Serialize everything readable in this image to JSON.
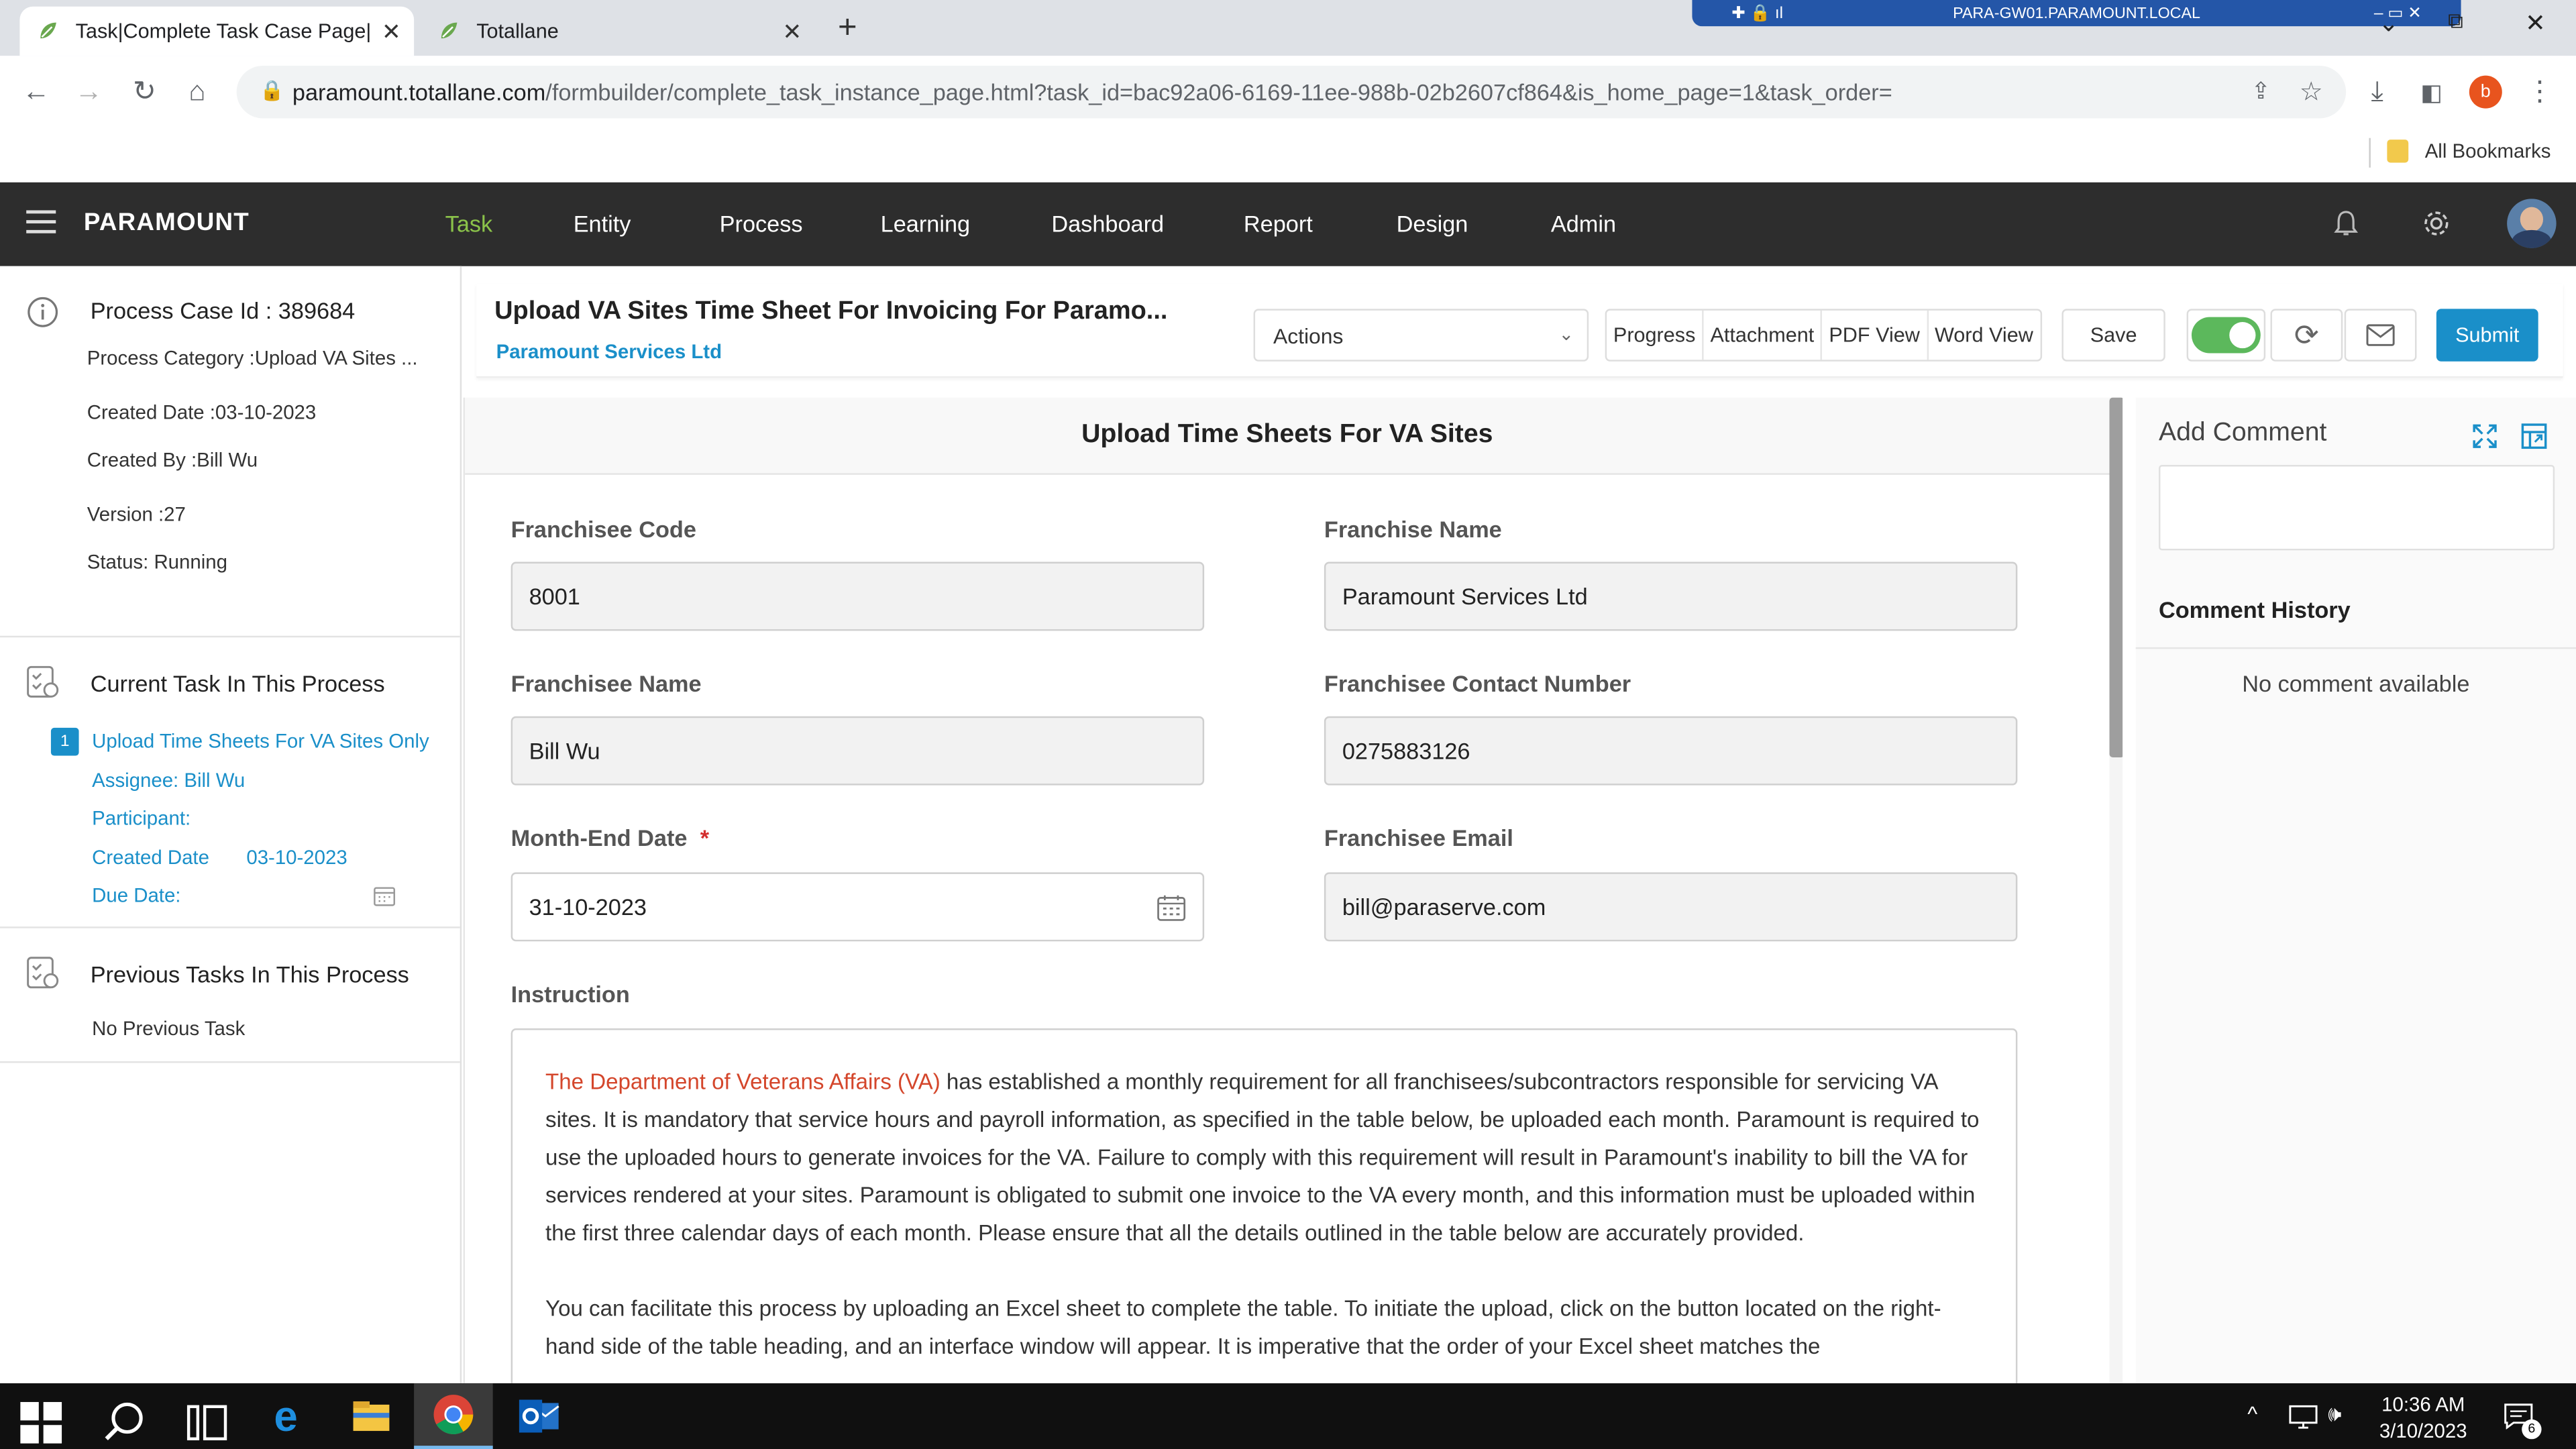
{
  "browser": {
    "tabs": [
      {
        "title": "Task|Complete Task Case Page|To"
      },
      {
        "title": "Totallane"
      }
    ],
    "new_tab": "+",
    "rdp_host": "PARA-GW01.PARAMOUNT.LOCAL",
    "url_host": "paramount.totallane.com",
    "url_path": "/formbuilder/complete_task_instance_page.html?task_id=bac92a06-6169-11ee-988b-02b2607cf864&is_home_page=1&task_order=",
    "profile_initial": "b",
    "bookmarks_label": "All Bookmarks"
  },
  "app": {
    "brand": "PARAMOUNT",
    "nav": [
      "Task",
      "Entity",
      "Process",
      "Learning",
      "Dashboard",
      "Report",
      "Design",
      "Admin"
    ],
    "active_nav": "Task"
  },
  "case": {
    "id_line": "Process Case Id : 389684",
    "category": "Process Category :Upload VA Sites ...",
    "created_date": "Created Date :03-10-2023",
    "created_by": "Created By :Bill Wu",
    "version": "Version :27",
    "status": "Status: Running"
  },
  "current_task": {
    "heading": "Current Task In This Process",
    "number": "1",
    "name": "Upload Time Sheets For VA Sites Only",
    "assignee": "Assignee: Bill Wu",
    "participant": "Participant:",
    "created_label": "Created Date",
    "created_value": "03-10-2023",
    "due_label": "Due Date:"
  },
  "previous_tasks": {
    "heading": "Previous Tasks In This Process",
    "empty": "No Previous Task"
  },
  "task_header": {
    "title": "Upload VA Sites Time Sheet For Invoicing For Paramo...",
    "company": "Paramount Services Ltd",
    "actions_placeholder": "Actions",
    "buttons": [
      "Progress",
      "Attachment",
      "PDF View",
      "Word View"
    ],
    "save": "Save",
    "submit": "Submit",
    "toggle_on": true
  },
  "form": {
    "title": "Upload Time Sheets For VA Sites",
    "fields": {
      "franchisee_code": {
        "label": "Franchisee Code",
        "value": "8001"
      },
      "franchise_name": {
        "label": "Franchise Name",
        "value": "Paramount Services Ltd"
      },
      "franchisee_name": {
        "label": "Franchisee Name",
        "value": "Bill Wu"
      },
      "franchisee_contact": {
        "label": "Franchisee Contact Number",
        "value": "0275883126"
      },
      "month_end_date": {
        "label": "Month-End Date",
        "required_mark": "*",
        "value": "31-10-2023"
      },
      "franchisee_email": {
        "label": "Franchisee Email",
        "value": "bill@paraserve.com"
      }
    },
    "instruction_label": "Instruction",
    "instruction": {
      "highlight": "The Department of Veterans Affairs (VA)",
      "para1_rest": " has established a monthly requirement for all franchisees/subcontractors responsible for servicing VA sites. It is mandatory that service hours and payroll information, as specified in the table below, be uploaded each month. Paramount is required to use the uploaded hours to generate invoices for the VA. Failure to comply with this requirement will result in Paramount's inability to bill the VA for services rendered at your sites. Paramount is obligated to submit one invoice to the VA every month, and this information must be uploaded within the first three calendar days of each month. Please ensure that all the details outlined in the table below are accurately provided.",
      "para2": "You can facilitate this process by uploading an Excel sheet to complete the table. To initiate the upload, click on the button located on the right-hand side of the table heading, and an interface window will appear. It is imperative that the order of your Excel sheet matches the"
    }
  },
  "comments": {
    "add_label": "Add Comment",
    "history_label": "Comment History",
    "empty": "No comment available"
  },
  "taskbar": {
    "time": "10:36 AM",
    "date": "3/10/2023",
    "notification_count": "6"
  },
  "colors": {
    "brand_green": "#8bc34a",
    "link_blue": "#1a8fc9",
    "submit_blue": "#1a8fc9",
    "highlight_red": "#d4462b",
    "toggle_green": "#5cb85c",
    "appbar_dark": "#2d2d2d"
  }
}
